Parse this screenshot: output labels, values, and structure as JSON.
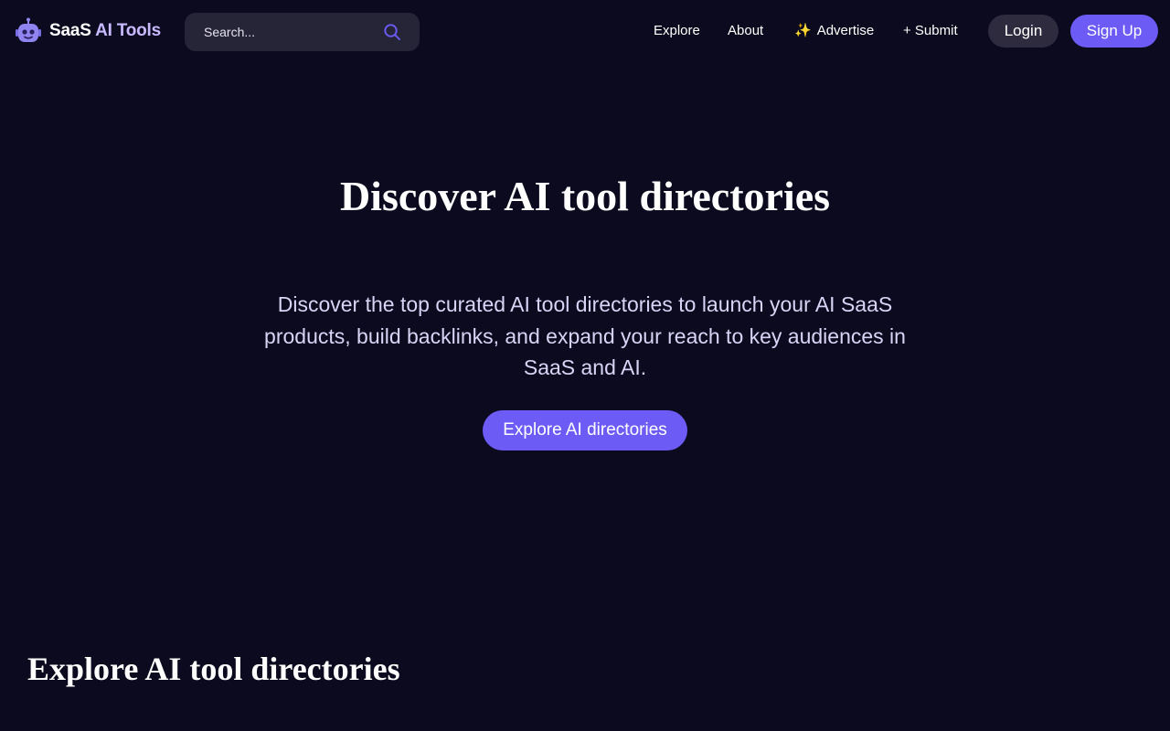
{
  "brand": {
    "name_primary": "SaaS",
    "name_accent": "AI Tools",
    "icon": "robot-icon",
    "accent_color": "#c9b9ff"
  },
  "search": {
    "placeholder": "Search...",
    "icon": "search-icon"
  },
  "nav": {
    "links": [
      {
        "label": "Explore"
      },
      {
        "label": "About"
      },
      {
        "label": "Advertise",
        "icon": "sparkles-icon",
        "icon_glyph": "✨"
      },
      {
        "label": "+ Submit"
      }
    ],
    "login_label": "Login",
    "signup_label": "Sign Up"
  },
  "hero": {
    "title": "Discover AI tool directories",
    "subtitle": "Discover the top curated AI tool directories to launch your AI SaaS products, build backlinks, and expand your reach to key audiences in SaaS and AI.",
    "cta_label": "Explore AI directories"
  },
  "section": {
    "title": "Explore AI tool directories"
  },
  "colors": {
    "background": "#0b0a1e",
    "primary": "#6c5cf5",
    "search_bg": "#262437",
    "login_bg": "#2d2b3d",
    "subtitle_text": "#d9d4f5"
  }
}
